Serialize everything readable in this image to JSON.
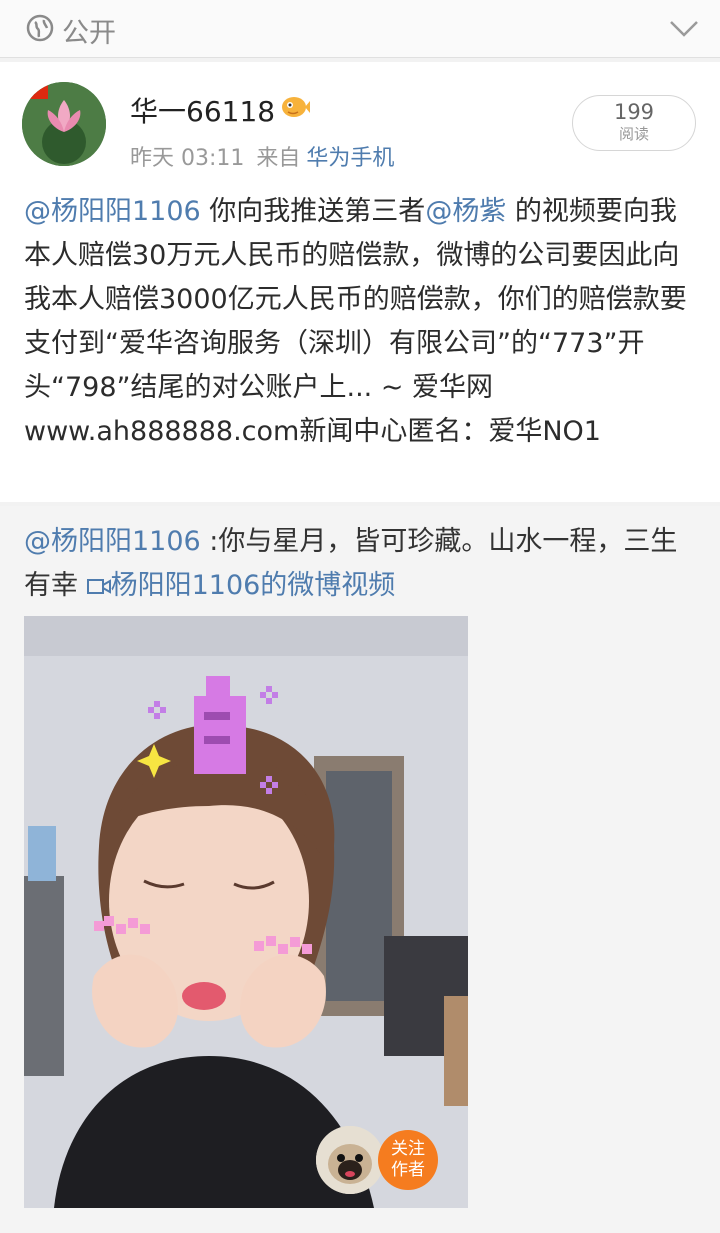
{
  "topbar": {
    "visibility_label": "公开"
  },
  "post": {
    "author": "华一66118",
    "time": "昨天 03:11",
    "source_prefix": "来自",
    "device": "华为手机",
    "reads_count": "199",
    "reads_label": "阅读",
    "body": {
      "mention1": "@杨阳阳1106",
      "text1": " 你向我推送第三者",
      "mention2": "@杨紫",
      "text2": " 的视频要向我本人赔偿30万元人民币的赔偿款，微博的公司要因此向我本人赔偿3000亿元人民币的赔偿款，你们的赔偿款要支付到“爱华咨询服务（深圳）有限公司”的“773”开头“798”结尾的对公账户上... ~ 爱华网www.ah888888.com新闻中心匿名：爱华NO1"
    }
  },
  "repost": {
    "mention": "@杨阳阳1106",
    "text": " :你与星月，皆可珍藏。山水一程，三生有幸 ",
    "video_link": "杨阳阳1106的微博视频",
    "follow_line1": "关注",
    "follow_line2": "作者"
  },
  "colors": {
    "link": "#4f7cae",
    "follow": "#f57c1f"
  }
}
